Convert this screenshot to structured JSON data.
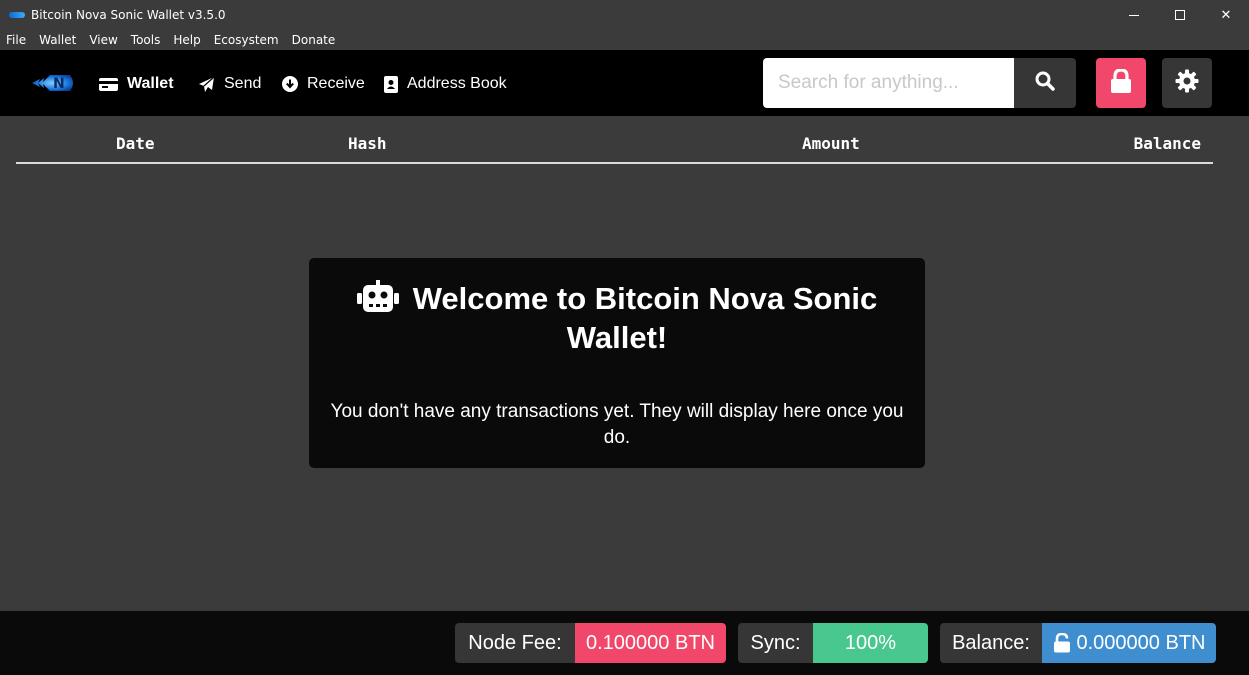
{
  "window": {
    "title": "Bitcoin Nova Sonic Wallet v3.5.0",
    "controls": {
      "minimize": "",
      "maximize": "",
      "close": "✕"
    }
  },
  "menu": [
    "File",
    "Wallet",
    "View",
    "Tools",
    "Help",
    "Ecosystem",
    "Donate"
  ],
  "nav": {
    "items": [
      {
        "label": "Wallet",
        "icon": "wallet-icon",
        "active": true
      },
      {
        "label": "Send",
        "icon": "paper-plane-icon",
        "active": false
      },
      {
        "label": "Receive",
        "icon": "arrow-circle-down-icon",
        "active": false
      },
      {
        "label": "Address Book",
        "icon": "address-book-icon",
        "active": false
      }
    ],
    "search": {
      "placeholder": "Search for anything..."
    },
    "colors": {
      "lock_button": "#f0476b",
      "dark_button": "#363636"
    }
  },
  "table": {
    "columns": [
      "Date",
      "Hash",
      "Amount",
      "Balance"
    ]
  },
  "welcome": {
    "title": "Welcome to Bitcoin Nova Sonic Wallet!",
    "message": "You don't have any transactions yet. They will display here once you do.",
    "icon": "robot-icon"
  },
  "footer": {
    "node_fee": {
      "label": "Node Fee:",
      "value": "0.100000 BTN",
      "color": "#f0476b"
    },
    "sync": {
      "label": "Sync:",
      "value": "100%",
      "color": "#48c78e"
    },
    "balance": {
      "label": "Balance:",
      "value": "0.000000 BTN",
      "color": "#3e8ed0",
      "icon": "unlock-icon"
    }
  }
}
